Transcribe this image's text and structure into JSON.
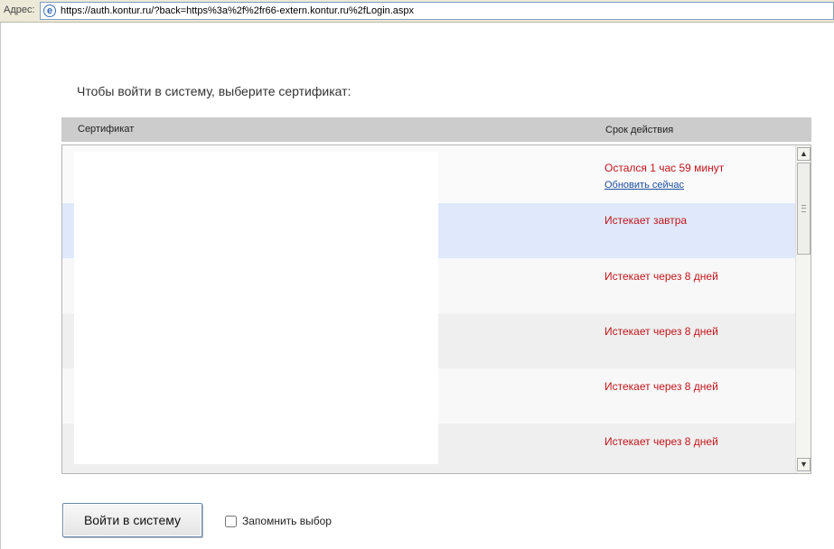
{
  "address_bar": {
    "label": "Адрес:",
    "url": "https://auth.kontur.ru/?back=https%3a%2f%2fr66-extern.kontur.ru%2fLogin.aspx",
    "icon": "ie-page-icon"
  },
  "prompt": "Чтобы войти в систему, выберите сертификат:",
  "table": {
    "columns": [
      "Сертификат",
      "Срок действия"
    ],
    "rows": [
      {
        "certificate": "",
        "validity": "Остался 1 час 59 минут",
        "action": "Обновить сейчас"
      },
      {
        "certificate": "",
        "validity": "Истекает завтра",
        "selected": true
      },
      {
        "certificate": "",
        "validity": "Истекает через 8 дней"
      },
      {
        "certificate": "",
        "validity": "Истекает через 8 дней"
      },
      {
        "certificate": "",
        "validity": "Истекает через 8 дней"
      },
      {
        "certificate": "",
        "validity": "Истекает через 8 дней"
      }
    ]
  },
  "colors": {
    "status_red": "#c0151a",
    "link_blue": "#1c4ea0",
    "header_gray": "#cccccc",
    "selected_row": "#e0e9fb"
  },
  "login_button": "Войти в систему",
  "remember": {
    "label": "Запомнить выбор",
    "checked": false
  }
}
